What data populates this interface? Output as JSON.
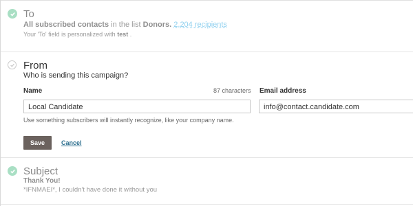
{
  "to": {
    "title": "To",
    "line1_prefix": "All subscribed contacts",
    "line1_middle": "in the list",
    "list_name": "Donors.",
    "recipients_link": "2,204 recipients",
    "personalized_prefix": "Your 'To' field is personalized with",
    "personalized_value": "test",
    "personalized_suffix": "."
  },
  "from": {
    "title": "From",
    "subtitle": "Who is sending this campaign?",
    "name_label": "Name",
    "char_count": "87 characters",
    "name_value": "Local Candidate",
    "email_label": "Email address",
    "email_value": "info@contact.candidate.com",
    "help_text": "Use something subscribers will instantly recognize, like your company name.",
    "save_label": "Save",
    "cancel_label": "Cancel"
  },
  "subject": {
    "title": "Subject",
    "line1": "Thank  You!",
    "line2": "*IFNMAEI*, I couldn't have done it without you"
  },
  "colors": {
    "done_check": "#a9dfc4",
    "link": "#8fd0ef",
    "cancel": "#2a6d8d",
    "save_button": "#6b625e"
  }
}
